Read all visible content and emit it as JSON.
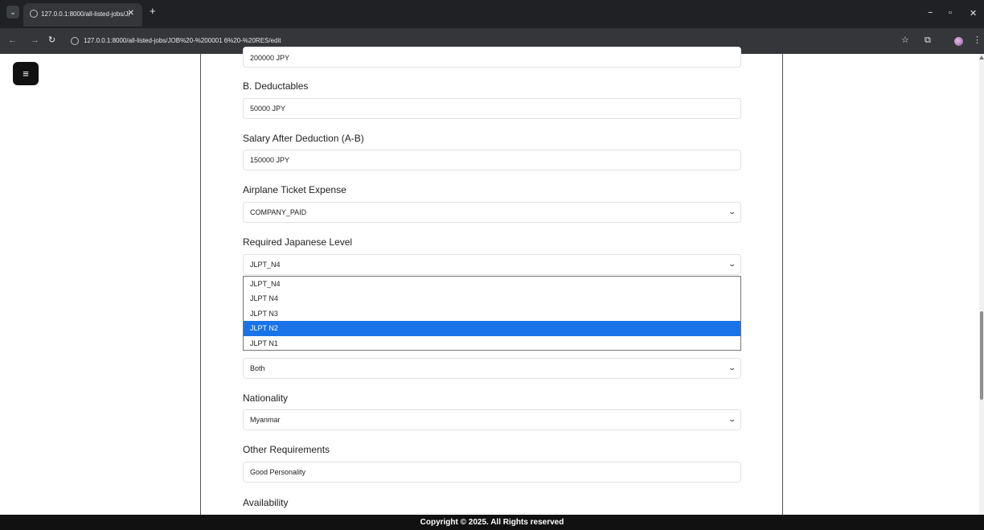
{
  "browser": {
    "tab_title": "127.0.0.1:8000/all-listed-jobs/J(",
    "new_tab": "+",
    "url": "127.0.0.1:8000/all-listed-jobs/JOB%20-%200001 6%20-%20RES/edit",
    "controls": {
      "minimize": "−",
      "maximize": "▫",
      "close": "✕"
    }
  },
  "page": {
    "menu_icon": "≡",
    "fields": [
      {
        "value": "200000 JPY"
      },
      {
        "label": "B. Deductables",
        "value": "50000 JPY"
      },
      {
        "label": "Salary After Deduction (A-B)",
        "value": "150000 JPY"
      },
      {
        "label": "Airplane Ticket Expense",
        "value": "COMPANY_PAID"
      },
      {
        "label": "Required Japanese Level",
        "value": "JLPT_N4"
      },
      {
        "value": "Both"
      },
      {
        "label": "Nationality",
        "value": "Myanmar"
      },
      {
        "label": "Other Requirements",
        "value": "Good Personality"
      },
      {
        "label": "Availability"
      }
    ],
    "japanese_level_options": [
      "JLPT_N4",
      "JLPT N4",
      "JLPT N3",
      "JLPT N2",
      "JLPT N1"
    ],
    "highlighted_option": "JLPT N2"
  },
  "footer": {
    "text": "Copyright © 2025. All Rights reserved"
  },
  "colors": {
    "accent": "#1a73e8",
    "footer_bg": "#111111",
    "chrome_bg": "#1f2124"
  }
}
